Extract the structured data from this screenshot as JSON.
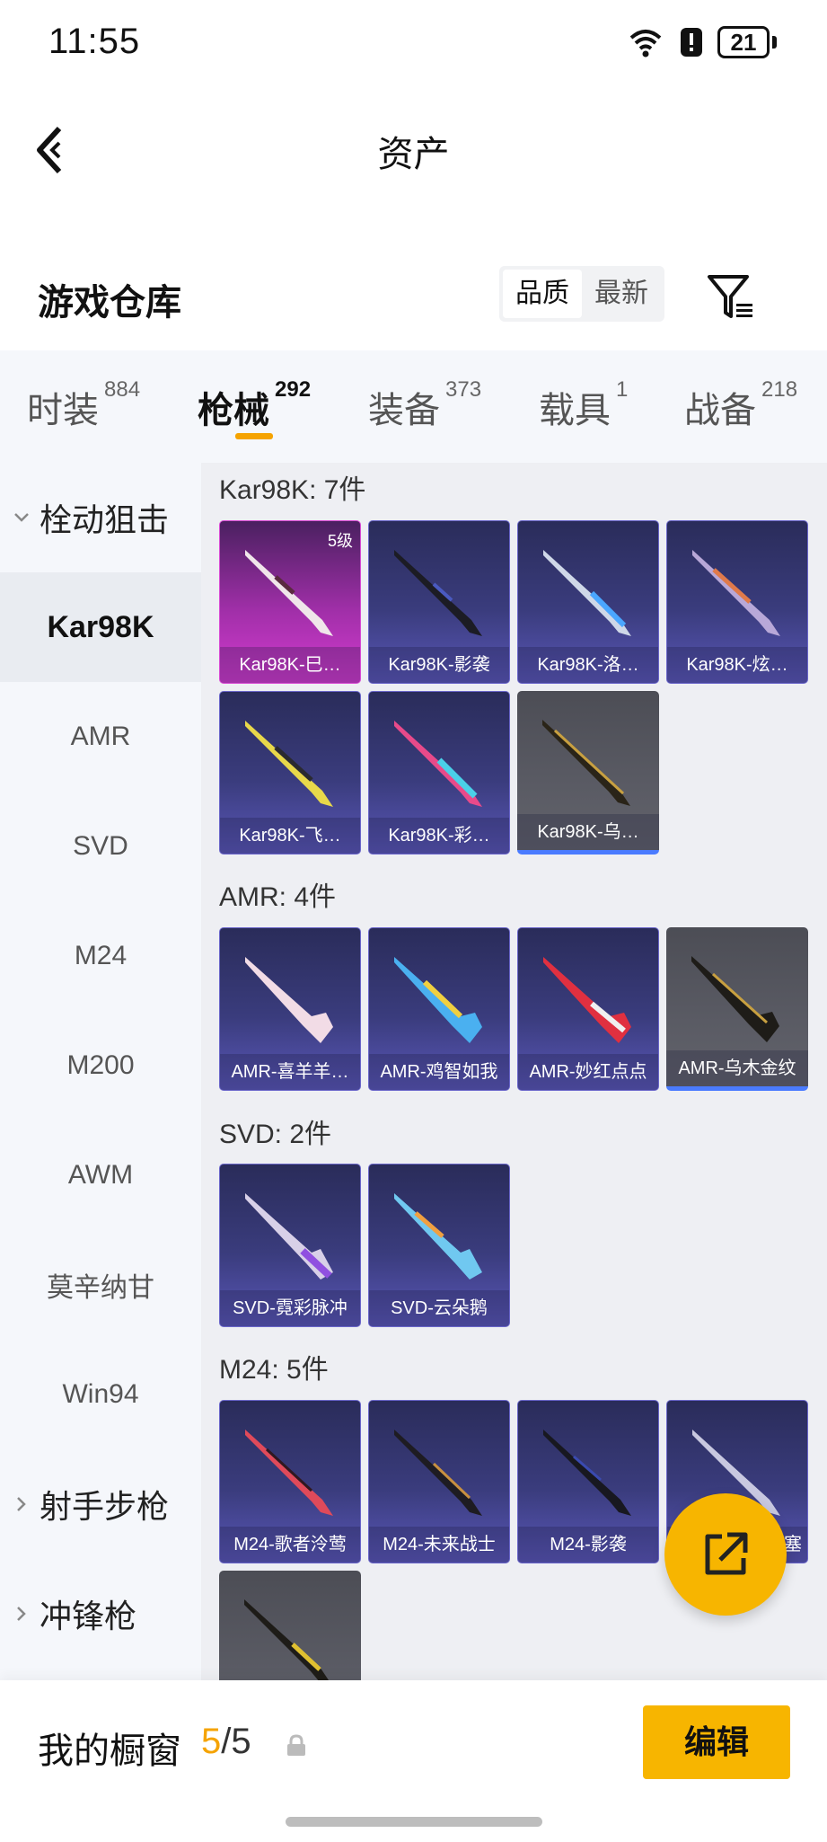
{
  "status_bar": {
    "time": "11:55",
    "battery": "21"
  },
  "nav": {
    "title": "资产"
  },
  "warehouse": {
    "title": "游戏仓库",
    "sort_options": [
      "品质",
      "最新"
    ]
  },
  "category_tabs": [
    {
      "label": "时装",
      "count": "884"
    },
    {
      "label": "枪械",
      "count": "292"
    },
    {
      "label": "装备",
      "count": "373"
    },
    {
      "label": "载具",
      "count": "1"
    },
    {
      "label": "战备",
      "count": "218"
    }
  ],
  "sidebar": {
    "group1": "栓动狙击",
    "items": [
      "Kar98K",
      "AMR",
      "SVD",
      "M24",
      "M200",
      "AWM",
      "莫辛纳甘",
      "Win94"
    ],
    "group2": "射手步枪",
    "group3": "冲锋枪"
  },
  "groups": [
    {
      "label": "Kar98K: 7件",
      "items": [
        {
          "name": "Kar98K-巳…",
          "level": "5级"
        },
        {
          "name": "Kar98K-影袭"
        },
        {
          "name": "Kar98K-洛…"
        },
        {
          "name": "Kar98K-炫…"
        },
        {
          "name": "Kar98K-飞…"
        },
        {
          "name": "Kar98K-彩…"
        },
        {
          "name": "Kar98K-乌…"
        }
      ]
    },
    {
      "label": "AMR: 4件",
      "items": [
        {
          "name": "AMR-喜羊羊…"
        },
        {
          "name": "AMR-鸡智如我"
        },
        {
          "name": "AMR-妙红点点"
        },
        {
          "name": "AMR-乌木金纹"
        }
      ]
    },
    {
      "label": "SVD: 2件",
      "items": [
        {
          "name": "SVD-霓彩脉冲"
        },
        {
          "name": "SVD-云朵鹅"
        }
      ]
    },
    {
      "label": "M24: 5件",
      "items": [
        {
          "name": "M24-歌者泠莺"
        },
        {
          "name": "M24-未来战士"
        },
        {
          "name": "M24-影袭"
        },
        {
          "name": "塞"
        },
        {
          "name": ""
        }
      ]
    }
  ],
  "bottom": {
    "label": "我的橱窗",
    "current": "5",
    "separator": "/",
    "total": "5",
    "edit_label": "编辑"
  },
  "colors": {
    "accent": "#f7b500",
    "tab_underline": "#f5a300",
    "card_purple": "#3a3c7d",
    "card_pink": "#d43bd0",
    "card_gray": "#5a5b64"
  }
}
